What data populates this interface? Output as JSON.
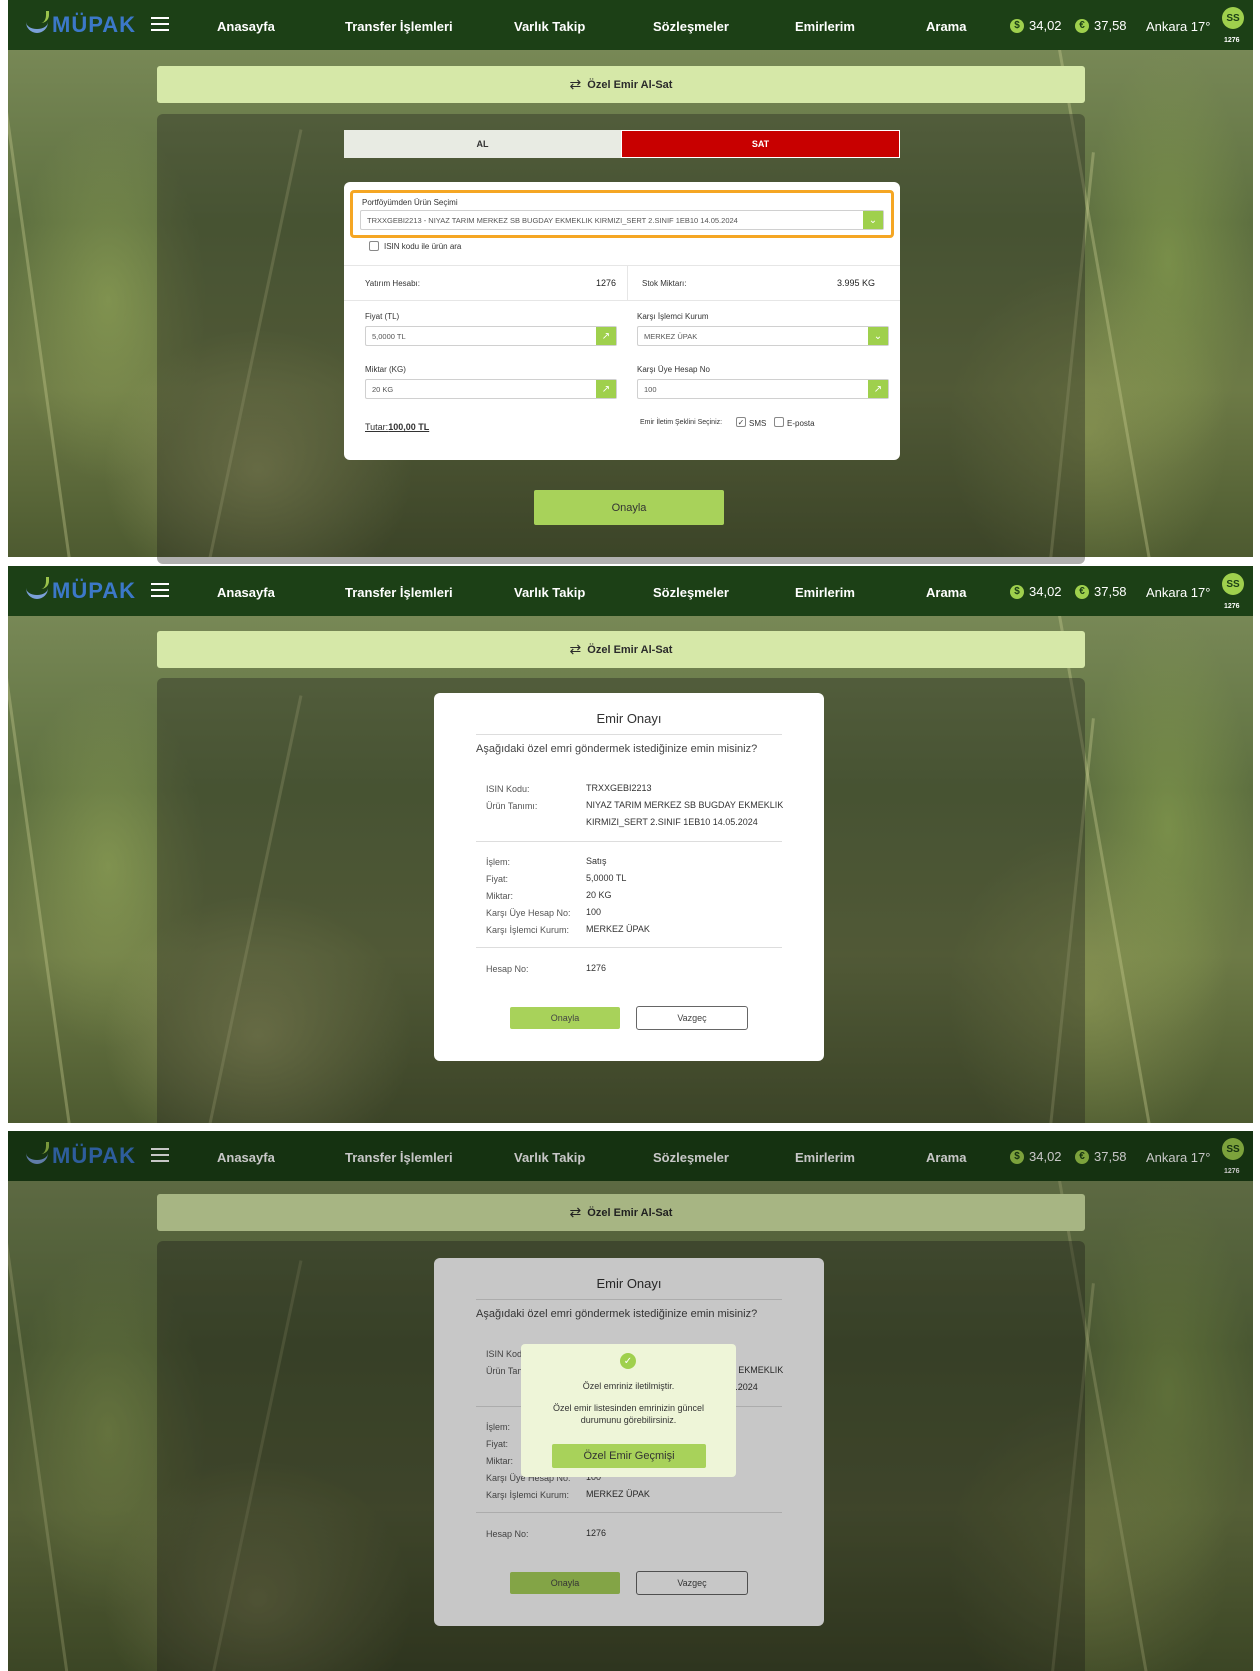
{
  "nav": {
    "logo": "MÜPAK",
    "items": [
      "Anasayfa",
      "Transfer İşlemleri",
      "Varlık Takip",
      "Sözleşmeler",
      "Emirlerim",
      "Arama"
    ],
    "usd": "34,02",
    "eur": "37,58",
    "weather": "Ankara 17°",
    "avatar_initials": "SS",
    "account_no": "1276"
  },
  "page_title": "Özel Emir Al-Sat",
  "form": {
    "tab_buy": "AL",
    "tab_sell": "SAT",
    "product_label": "Portföyümden Ürün Seçimi",
    "product_value": "TRXXGEBI2213 - NIYAZ TARIM MERKEZ SB BUGDAY EKMEKLIK KIRMIZI_SERT 2.SINIF 1EB10 14.05.2024",
    "isin_search_label": "ISIN kodu ile ürün ara",
    "account_label": "Yatırım Hesabı:",
    "account_value": "1276",
    "stock_label": "Stok Miktarı:",
    "stock_value": "3.995 KG",
    "price_label": "Fiyat (TL)",
    "price_value": "5,0000 TL",
    "counter_inst_label": "Karşı İşlemci Kurum",
    "counter_inst_value": "MERKEZ ÜPAK",
    "qty_label": "Miktar (KG)",
    "qty_value": "20 KG",
    "counter_acct_label": "Karşı Üye Hesap No",
    "counter_acct_value": "100",
    "total_label": "Tutar:",
    "total_value": "100,00 TL",
    "contact_label": "Emir İletim Şeklini Seçiniz:",
    "sms_label": "SMS",
    "email_label": "E-posta",
    "submit": "Onayla"
  },
  "modal": {
    "title": "Emir Onayı",
    "question": "Aşağıdaki özel emri göndermek istediğinize emin misiniz?",
    "isin_label": "ISIN Kodu:",
    "isin_value": "TRXXGEBI2213",
    "product_label": "Ürün Tanımı:",
    "product_line1": "NIYAZ TARIM MERKEZ SB BUGDAY EKMEKLIK",
    "product_line2": "KIRMIZI_SERT 2.SINIF 1EB10 14.05.2024",
    "op_label": "İşlem:",
    "op_value": "Satış",
    "price_label": "Fiyat:",
    "price_value": "5,0000 TL",
    "qty_label": "Miktar:",
    "qty_value": "20 KG",
    "counter_acct_label": "Karşı Üye Hesap No:",
    "counter_acct_value": "100",
    "counter_inst_label": "Karşı İşlemci Kurum:",
    "counter_inst_value": "MERKEZ ÜPAK",
    "acct_label": "Hesap No:",
    "acct_value": "1276",
    "ok": "Onayla",
    "cancel": "Vazgeç"
  },
  "toast": {
    "line1": "Özel emriniz iletilmiştir.",
    "line2": "Özel emir listesinden emrinizin güncel durumunu görebilirsiniz.",
    "button": "Özel Emir Geçmişi"
  }
}
